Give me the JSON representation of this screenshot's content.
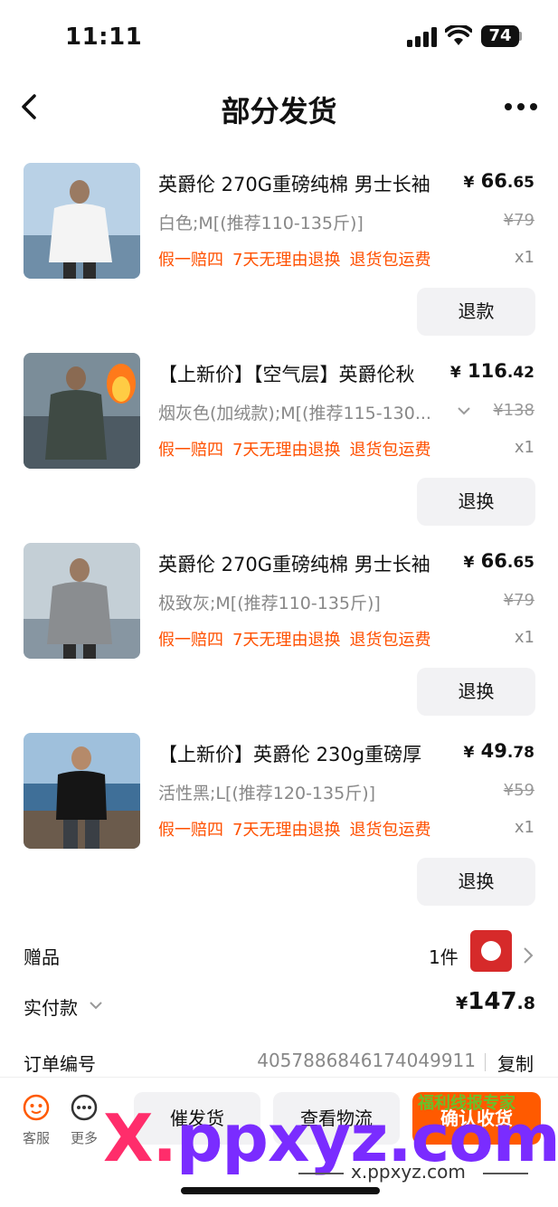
{
  "status_bar": {
    "time": "11:11",
    "battery": "74"
  },
  "nav": {
    "title": "部分发货"
  },
  "products": [
    {
      "title": "英爵伦 270G重磅纯棉 男士长袖",
      "price_int": "66",
      "price_dec": ".65",
      "spec": "白色;M[(推荐110-135斤)]",
      "original_price": "¥79",
      "tags": [
        "假一赔四",
        "7天无理由退换",
        "退货包运费"
      ],
      "qty": "x1",
      "action": "退款"
    },
    {
      "title": "【上新价】【空气层】英爵伦秋",
      "price_int": "116",
      "price_dec": ".42",
      "spec": "烟灰色(加绒款);M[(推荐115-130...",
      "original_price": "¥138",
      "tags": [
        "假一赔四",
        "7天无理由退换",
        "退货包运费"
      ],
      "qty": "x1",
      "action": "退换"
    },
    {
      "title": "英爵伦 270G重磅纯棉 男士长袖",
      "price_int": "66",
      "price_dec": ".65",
      "spec": "极致灰;M[(推荐110-135斤)]",
      "original_price": "¥79",
      "tags": [
        "假一赔四",
        "7天无理由退换",
        "退货包运费"
      ],
      "qty": "x1",
      "action": "退换"
    },
    {
      "title": "【上新价】英爵伦 230g重磅厚",
      "price_int": "49",
      "price_dec": ".78",
      "spec": "活性黑;L[(推荐120-135斤)]",
      "original_price": "¥59",
      "tags": [
        "假一赔四",
        "7天无理由退换",
        "退货包运费"
      ],
      "qty": "x1",
      "action": "退换"
    }
  ],
  "currency": "¥",
  "gift": {
    "label": "赠品",
    "count": "1件"
  },
  "paid": {
    "label": "实付款",
    "int": "147",
    "dec": ".8"
  },
  "order": {
    "label": "订单编号",
    "number": "4057886846174049911",
    "copy": "复制"
  },
  "bottom": {
    "service": "客服",
    "more": "更多",
    "urge": "催发货",
    "logistics": "查看物流",
    "confirm": "确认收货"
  },
  "watermark": {
    "logo_x": "X.",
    "logo_rest": "ppxyz.com",
    "url": "x.ppxyz.com",
    "badge": "福利线报专家"
  },
  "colors": {
    "accent": "#ff5000",
    "confirm": "#ff5a00",
    "watermark_pink": "#ff2d6b",
    "watermark_purple": "#7a2cff"
  }
}
